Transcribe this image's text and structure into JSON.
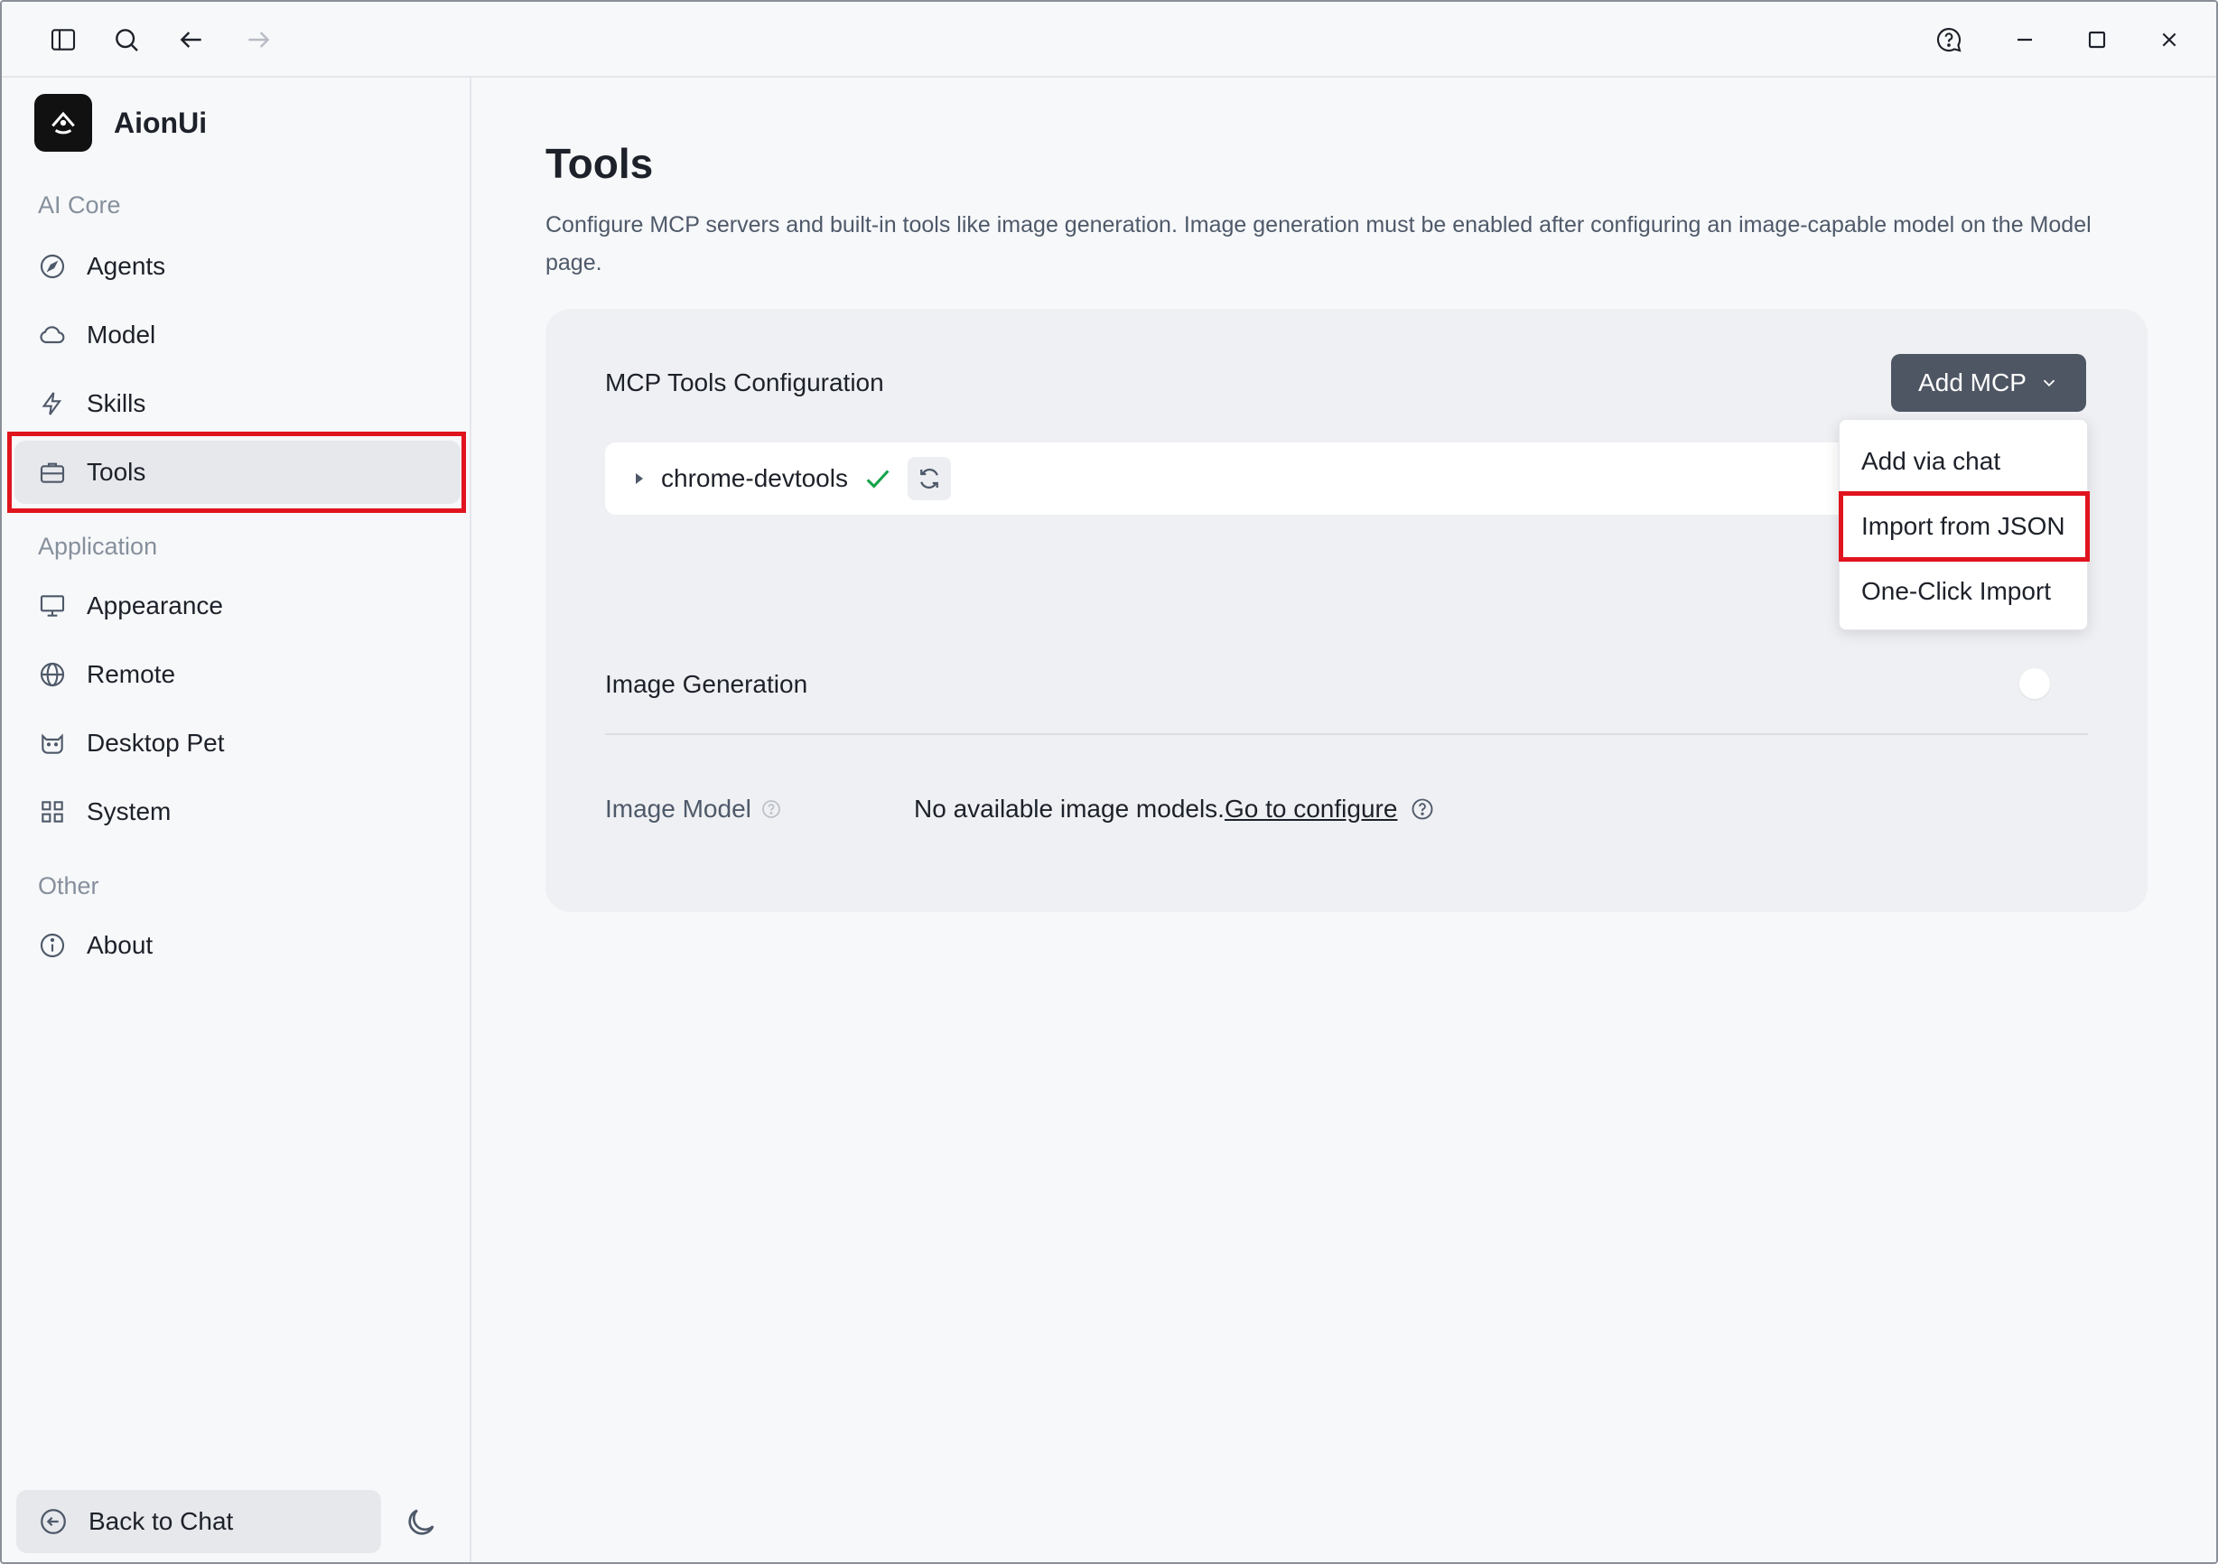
{
  "app": {
    "name": "AionUi"
  },
  "sidebar": {
    "sections": [
      {
        "label": "AI Core"
      },
      {
        "label": "Application"
      },
      {
        "label": "Other"
      }
    ],
    "items": [
      {
        "label": "Agents"
      },
      {
        "label": "Model"
      },
      {
        "label": "Skills"
      },
      {
        "label": "Tools"
      },
      {
        "label": "Appearance"
      },
      {
        "label": "Remote"
      },
      {
        "label": "Desktop Pet"
      },
      {
        "label": "System"
      },
      {
        "label": "About"
      }
    ],
    "active": "Tools",
    "back_label": "Back to Chat"
  },
  "page": {
    "title": "Tools",
    "description": "Configure MCP servers and built-in tools like image generation. Image generation must be enabled after configuring an image-capable model on the Model page."
  },
  "mcp": {
    "title": "MCP Tools Configuration",
    "add_button": "Add MCP",
    "servers": [
      {
        "name": "chrome-devtools",
        "status": "connected"
      }
    ],
    "menu": [
      {
        "label": "Add via chat"
      },
      {
        "label": "Import from JSON"
      },
      {
        "label": "One-Click Import"
      }
    ]
  },
  "image_generation": {
    "title": "Image Generation",
    "enabled": false,
    "model_label": "Image Model",
    "model_value": "No available image models.",
    "configure_link": "Go to configure"
  },
  "colors": {
    "accent_button": "#4e5664",
    "highlight": "#e0141e",
    "success": "#16a34a"
  }
}
